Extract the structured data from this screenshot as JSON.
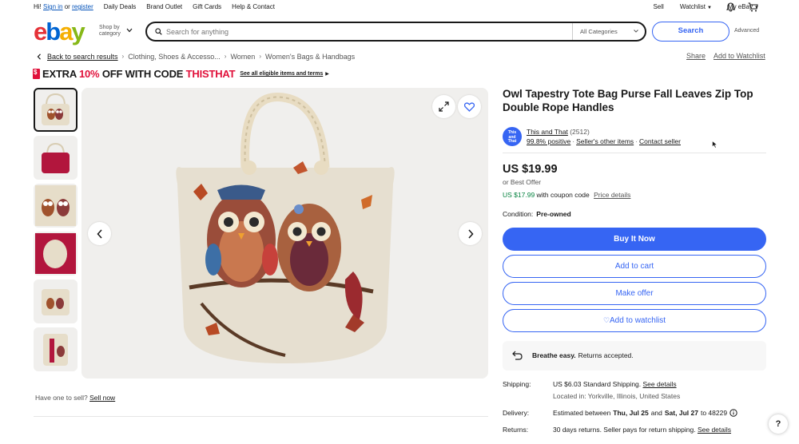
{
  "topnav": {
    "greeting_prefix": "Hi!",
    "sign_in": "Sign in",
    "or": "or",
    "register": "register",
    "links": [
      "Daily Deals",
      "Brand Outlet",
      "Gift Cards",
      "Help & Contact"
    ],
    "sell": "Sell",
    "watchlist": "Watchlist",
    "my_ebay": "My eBay"
  },
  "header": {
    "logo": [
      "e",
      "b",
      "a",
      "y"
    ],
    "shop_by_1": "Shop by",
    "shop_by_2": "category",
    "search_placeholder": "Search for anything",
    "category_select": "All Categories",
    "search_button": "Search",
    "advanced": "Advanced"
  },
  "breadcrumb": {
    "back": "Back to search results",
    "items": [
      "Clothing, Shoes & Accesso...",
      "Women",
      "Women's Bags & Handbags"
    ],
    "share": "Share",
    "add_to_watchlist": "Add to Watchlist"
  },
  "promo": {
    "part1": "EXTRA",
    "pct": "10%",
    "part2": "OFF WITH CODE",
    "code": "THISTHAT",
    "link": "See all eligible items and terms"
  },
  "gallery": {
    "sell_prompt": "Have one to sell?",
    "sell_now": "Sell now"
  },
  "item": {
    "title": "Owl Tapestry Tote Bag Purse Fall Leaves Zip Top Double Rope Handles",
    "seller_logo_text": [
      "This",
      "and",
      "That"
    ],
    "seller_name": "This and That",
    "seller_count": "(2512)",
    "positive": "99.8% positive",
    "other_items": "Seller's other items",
    "contact": "Contact seller",
    "price": "US $19.99",
    "best_offer": "or Best Offer",
    "coupon_price": "US $17.99",
    "coupon_text": "with coupon code",
    "price_details": "Price details",
    "condition_label": "Condition:",
    "condition_value": "Pre-owned",
    "buy_now": "Buy It Now",
    "add_to_cart": "Add to cart",
    "make_offer": "Make offer",
    "add_to_watchlist": "Add to watchlist",
    "breathe_bold": "Breathe easy.",
    "breathe_text": "Returns accepted.",
    "shipping_label": "Shipping:",
    "shipping_price": "US $6.03",
    "shipping_type": "Standard Shipping.",
    "see_details": "See details",
    "located": "Located in: Yorkville, Illinois, United States",
    "delivery_label": "Delivery:",
    "delivery_prefix": "Estimated between",
    "delivery_from": "Thu, Jul 25",
    "delivery_and": "and",
    "delivery_to": "Sat, Jul 27",
    "delivery_zip": "to 48229",
    "returns_label": "Returns:",
    "returns_text": "30 days returns. Seller pays for return shipping.",
    "returns_link": "See details"
  },
  "colors": {
    "primary": "#3665f3",
    "promo_red": "#e0103a",
    "coupon_green": "#05823f"
  },
  "icons": [
    "search-icon",
    "bell-icon",
    "cart-icon",
    "expand-icon",
    "heart-icon",
    "chevron-left-icon",
    "chevron-right-icon",
    "return-arrow-icon",
    "info-icon",
    "help-icon"
  ]
}
